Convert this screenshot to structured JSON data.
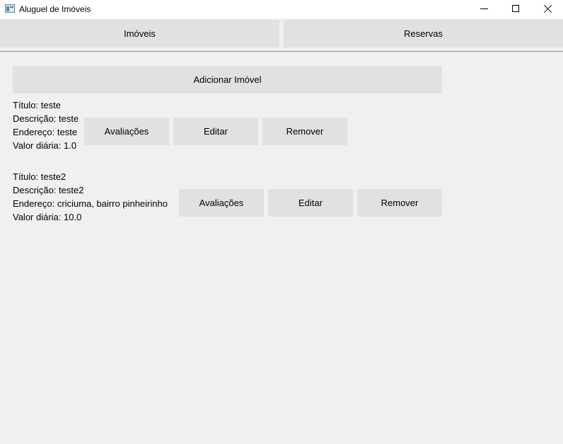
{
  "window": {
    "title": "Aluguel de Imóveis"
  },
  "tabs": [
    {
      "label": "Imóveis"
    },
    {
      "label": "Reservas"
    }
  ],
  "actions": {
    "add_property_label": "Adicionar Imóvel"
  },
  "properties": [
    {
      "title": "Título: teste",
      "description": "Descrição: teste",
      "address": "Endereço: teste",
      "daily_value": "Valor diária: 1.0",
      "buttons": {
        "reviews": "Avaliações",
        "edit": "Editar",
        "remove": "Remover"
      }
    },
    {
      "title": "Título: teste2",
      "description": "Descrição: teste2",
      "address": "Endereço: criciuma, bairro pinheirinho",
      "daily_value": "Valor diária: 10.0",
      "buttons": {
        "reviews": "Avaliações",
        "edit": "Editar",
        "remove": "Remover"
      }
    }
  ],
  "icons": {
    "app": "app-window-icon",
    "minimize": "minimize-icon",
    "maximize": "maximize-icon",
    "close": "close-icon"
  },
  "colors": {
    "background": "#f0f0f0",
    "button": "#e1e1e1",
    "titlebar": "#ffffff",
    "divider": "#8c8c8c"
  }
}
